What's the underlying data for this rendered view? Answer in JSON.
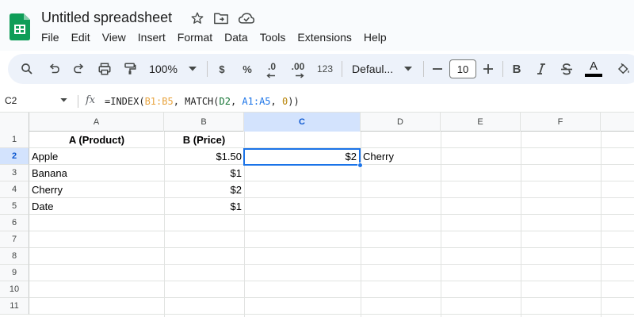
{
  "app": {
    "title": "Untitled spreadsheet",
    "accent_color": "#0f9d58",
    "menu": [
      "File",
      "Edit",
      "View",
      "Insert",
      "Format",
      "Data",
      "Tools",
      "Extensions",
      "Help"
    ]
  },
  "title_icons": [
    "star-icon",
    "move-to-folder-icon",
    "cloud-status-icon"
  ],
  "toolbar": {
    "zoom": "100%",
    "currency_label": "$",
    "percent_label": "%",
    "decrease_decimal_label": ".0",
    "increase_decimal_label": ".00",
    "number_format_label": "123",
    "font_name": "Defaul...",
    "font_size": "10",
    "bold_label": "B",
    "text_color_label": "A"
  },
  "formula_bar": {
    "name_box": "C2",
    "fx_label": "fx",
    "formula": {
      "prefix": "=INDEX(",
      "ref1": "B1:B5",
      "mid1": ", MATCH(",
      "ref2": "D2",
      "mid2": ", ",
      "ref3": "A1:A5",
      "mid3": ", ",
      "num": "0",
      "suffix": "))"
    }
  },
  "grid": {
    "columns": [
      "A",
      "B",
      "C",
      "D",
      "E",
      "F"
    ],
    "active_column": "C",
    "rows": [
      "1",
      "2",
      "3",
      "4",
      "5",
      "6",
      "7",
      "8",
      "9",
      "10",
      "11"
    ],
    "active_row": "2",
    "cells": {
      "A1": "A (Product)",
      "B1": "B (Price)",
      "A2": "Apple",
      "B2": "$1.50",
      "C2": "$2",
      "D2": "Cherry",
      "A3": "Banana",
      "B3": "$1",
      "A4": "Cherry",
      "B4": "$2",
      "A5": "Date",
      "B5": "$1"
    },
    "selection_color": "#1a73e8"
  }
}
